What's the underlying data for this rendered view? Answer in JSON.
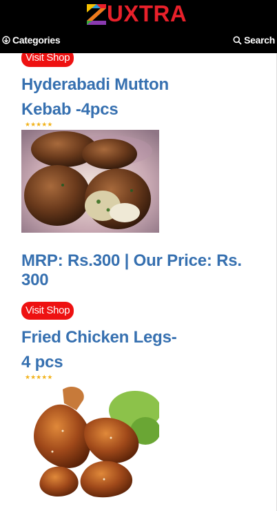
{
  "header": {
    "logo_text": "UXTRA",
    "nav_categories": "Categories",
    "nav_search": "Search"
  },
  "products": [
    {
      "visit_shop": "Visit Shop",
      "title_line1": "Hyderabadi Mutton",
      "title_line2": "Kebab -4pcs",
      "rating": 5,
      "image": "mutton-kebab-photo",
      "price": "MRP: Rs.300 | Our Price: Rs. 300"
    },
    {
      "visit_shop": "Visit Shop",
      "title_line1": "Fried Chicken Legs-",
      "title_line2": "4 pcs",
      "rating": 5,
      "image": "fried-chicken-legs-photo"
    }
  ],
  "colors": {
    "accent_red": "#ee1111",
    "title_blue": "#3670b0",
    "header_bg": "#000000",
    "star_gold": "#f2b21a"
  }
}
